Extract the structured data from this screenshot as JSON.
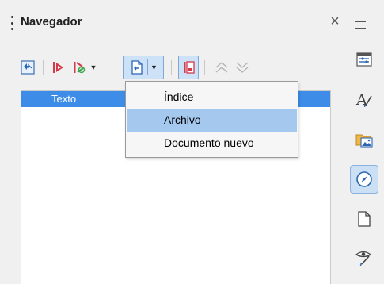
{
  "panel": {
    "title": "Navegador",
    "close_glyph": "×",
    "menu_icon": "hamburger-icon"
  },
  "toolbar": {
    "icons": [
      "content-view-icon",
      "previous-item-icon",
      "next-item-icon",
      "chevron-down-icon",
      "insert-as-icon",
      "chevron-down-icon",
      "list-box-icon",
      "promote-level-icon",
      "demote-level-icon"
    ],
    "pressed": [
      "insert-as",
      "list-box"
    ]
  },
  "tree": {
    "selected_item": "Texto"
  },
  "dropdown": {
    "items": [
      {
        "accel": "Í",
        "rest": "ndice"
      },
      {
        "accel": "A",
        "rest": "rchivo",
        "highlighted": true
      },
      {
        "accel": "D",
        "rest": "ocumento nuevo"
      }
    ]
  },
  "sidebar": {
    "icons": [
      "properties-icon",
      "styles-icon",
      "gallery-icon",
      "navigator-icon",
      "page-icon",
      "style-inspector-icon"
    ],
    "active": "navigator-icon"
  },
  "colors": {
    "selection": "#3c8ce8",
    "menu_highlight": "#a5c8ef",
    "pressed_bg": "#cde2f7"
  }
}
